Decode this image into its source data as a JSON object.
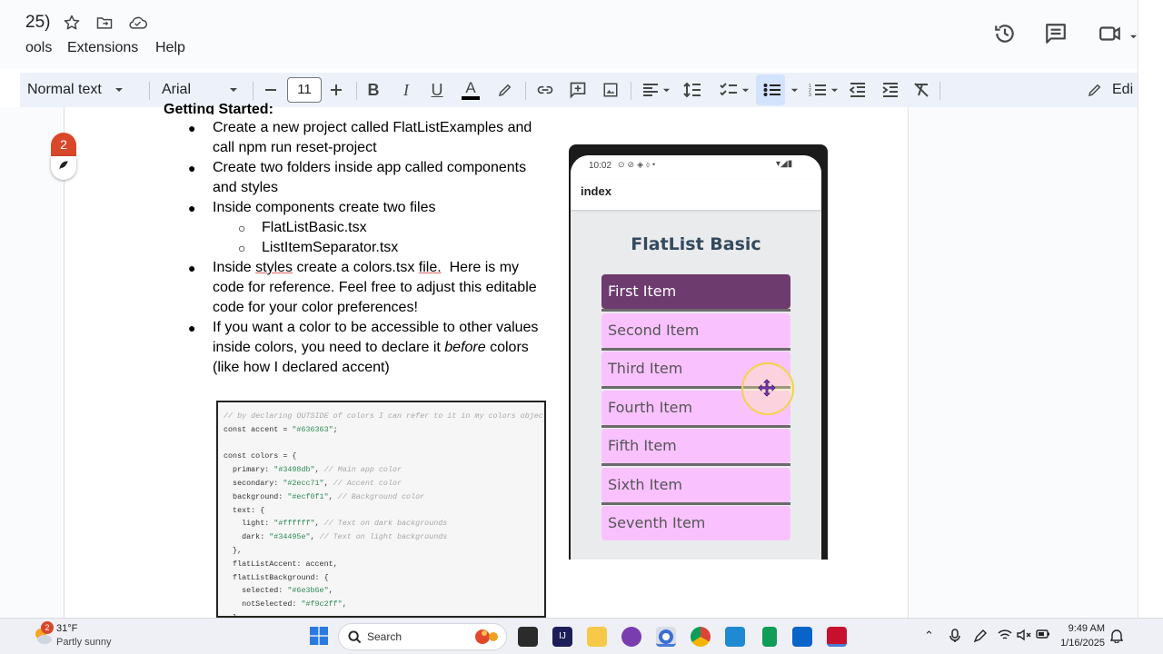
{
  "docs": {
    "title_fragment": "25)",
    "menu": [
      "ools",
      "Extensions",
      "Help"
    ],
    "toolbar": {
      "style": "Normal text",
      "font": "Arial",
      "font_size": "11",
      "edit_label": "Edi"
    },
    "comment_count": "2"
  },
  "document": {
    "heading_fragment": "Getting Started:",
    "bullets": [
      {
        "lines": [
          "Create a new project called FlatListExamples and",
          "call npm run reset-project"
        ]
      },
      {
        "lines": [
          "Create two folders inside app called components",
          "and styles"
        ]
      },
      {
        "lines": [
          "Inside components create two files"
        ]
      }
    ],
    "sub_bullets": [
      "FlatListBasic.tsx",
      "ListItemSeparator.tsx"
    ],
    "bullet4": {
      "pre": "Inside ",
      "link1": "styles",
      "mid": " create a colors.tsx ",
      "link2": "file.",
      "post": "  Here is my",
      "line2": "code for reference. Feel free to adjust this editable",
      "line3": "code for your color preferences!"
    },
    "bullet5": {
      "line1": "If you want a color to be accessible to other values",
      "line2_pre": "inside colors, you need to declare it ",
      "line2_em": "before",
      "line2_post": " colors",
      "line3": "(like how I declared accent)"
    }
  },
  "code_image": {
    "lines": [
      {
        "c": "// by declaring OUTSIDE of colors I can refer to it in my colors object"
      },
      {
        "t": "const accent = ",
        "s": "\"#636363\"",
        "e": ";"
      },
      {
        "t": ""
      },
      {
        "t": "const colors = {"
      },
      {
        "t": "  primary: ",
        "s": "\"#3498db\"",
        "e": ", ",
        "cm": "// Main app color"
      },
      {
        "t": "  secondary: ",
        "s": "\"#2ecc71\"",
        "e": ", ",
        "cm": "// Accent color"
      },
      {
        "t": "  background: ",
        "s": "\"#ecf0f1\"",
        "e": ", ",
        "cm": "// Background color"
      },
      {
        "t": "  text: {"
      },
      {
        "t": "    light: ",
        "s": "\"#ffffff\"",
        "e": ", ",
        "cm": "// Text on dark backgrounds"
      },
      {
        "t": "    dark: ",
        "s": "\"#34495e\"",
        "e": ", ",
        "cm": "// Text on light backgrounds"
      },
      {
        "t": "  },"
      },
      {
        "t": "  flatListAccent: accent,"
      },
      {
        "t": "  flatListBackground: {"
      },
      {
        "t": "    selected: ",
        "s": "\"#6e3b6e\"",
        "e": ","
      },
      {
        "t": "    notSelected: ",
        "s": "\"#f9c2ff\"",
        "e": ","
      },
      {
        "t": "  },"
      }
    ]
  },
  "phone": {
    "time": "10:02",
    "appbar_title": "index",
    "list_title": "FlatList Basic",
    "items": [
      "First Item",
      "Second Item",
      "Third Item",
      "Fourth Item",
      "Fifth Item",
      "Sixth Item",
      "Seventh Item"
    ],
    "selected_index": 0,
    "colors": {
      "selected": "#6e3b6e",
      "notSelected": "#f9c2ff",
      "accent": "#636363",
      "title": "#34495e"
    }
  },
  "taskbar": {
    "weather_temp": "31°F",
    "weather_desc": "Partly sunny",
    "weather_badge": "2",
    "search_label": "Search",
    "time": "9:49 AM",
    "date": "1/16/2025"
  }
}
